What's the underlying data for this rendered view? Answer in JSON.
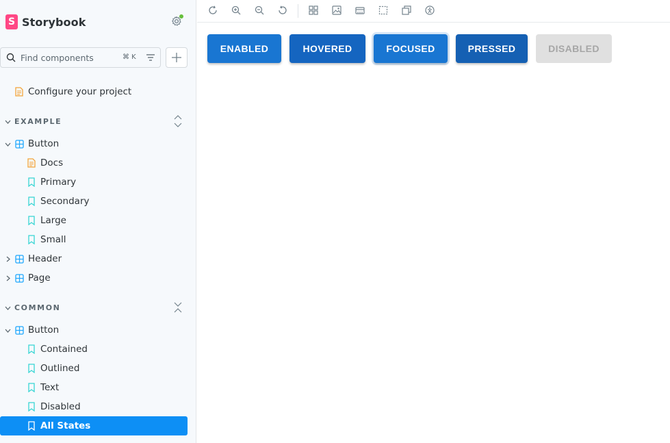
{
  "brand": {
    "name": "Storybook",
    "logo_letter": "S"
  },
  "search": {
    "placeholder": "Find components",
    "shortcut": "⌘ K"
  },
  "sidebar": {
    "configure": "Configure your project",
    "sections": [
      {
        "title": "EXAMPLE",
        "items": [
          {
            "label": "Button",
            "children": [
              "Docs",
              "Primary",
              "Secondary",
              "Large",
              "Small"
            ]
          },
          {
            "label": "Header"
          },
          {
            "label": "Page"
          }
        ]
      },
      {
        "title": "COMMON",
        "items": [
          {
            "label": "Button",
            "children": [
              "Contained",
              "Outlined",
              "Text",
              "Disabled",
              "All States"
            ]
          }
        ]
      }
    ],
    "selected": "All States"
  },
  "toolbar": {
    "icons": [
      "reload-icon",
      "zoom-in-icon",
      "zoom-out-icon",
      "zoom-reset-icon",
      "grid-icon",
      "background-icon",
      "viewport-icon",
      "outline-icon",
      "measure-icon",
      "accessibility-icon"
    ]
  },
  "preview": {
    "buttons": [
      {
        "label": "ENABLED",
        "state": "enabled"
      },
      {
        "label": "HOVERED",
        "state": "hovered"
      },
      {
        "label": "FOCUSED",
        "state": "focused"
      },
      {
        "label": "PRESSED",
        "state": "pressed"
      },
      {
        "label": "DISABLED",
        "state": "disabled"
      }
    ]
  },
  "colors": {
    "accent": "#0d8ff5",
    "brand": "#ff4785",
    "mui_primary": "#1976d2",
    "story_icon": "#37d5d3",
    "docs_icon": "#f4a43a",
    "component_icon": "#1ea7fd"
  }
}
